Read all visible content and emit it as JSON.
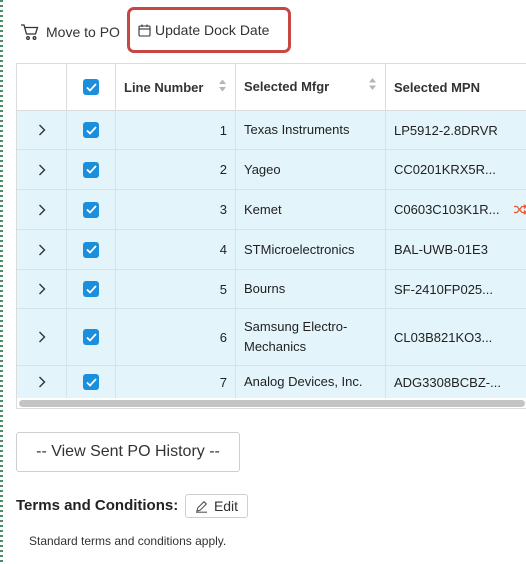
{
  "toolbar": {
    "move_label": "Move to PO",
    "update_label": "Update Dock Date"
  },
  "table": {
    "columns": [
      "Line Number",
      "Selected Mfgr",
      "Selected MPN"
    ],
    "rows": [
      {
        "line": "1",
        "mfgr": "Texas Instruments",
        "mpn": "LP5912-2.8DRVR"
      },
      {
        "line": "2",
        "mfgr": "Yageo",
        "mpn": "CC0201KRX5R..."
      },
      {
        "line": "3",
        "mfgr": "Kemet",
        "mpn": "C0603C103K1R..."
      },
      {
        "line": "4",
        "mfgr": "STMicroelectronics",
        "mpn": "BAL-UWB-01E3"
      },
      {
        "line": "5",
        "mfgr": "Bourns",
        "mpn": "SF-2410FP025..."
      },
      {
        "line": "6",
        "mfgr": "Samsung Electro-Mechanics",
        "mpn": "CL03B821KO3..."
      },
      {
        "line": "7",
        "mfgr": "Analog Devices, Inc.",
        "mpn": "ADG3308BCBZ-..."
      }
    ]
  },
  "history_label": "-- View Sent PO History --",
  "terms": {
    "label": "Terms and Conditions:",
    "edit_label": "Edit",
    "text": "Standard terms and conditions apply."
  },
  "colors": {
    "highlight_border": "#c74744",
    "checkbox": "#1a8fdd",
    "row_selected": "#e3f4fb",
    "shuffle_icon": "#e05a3a"
  }
}
